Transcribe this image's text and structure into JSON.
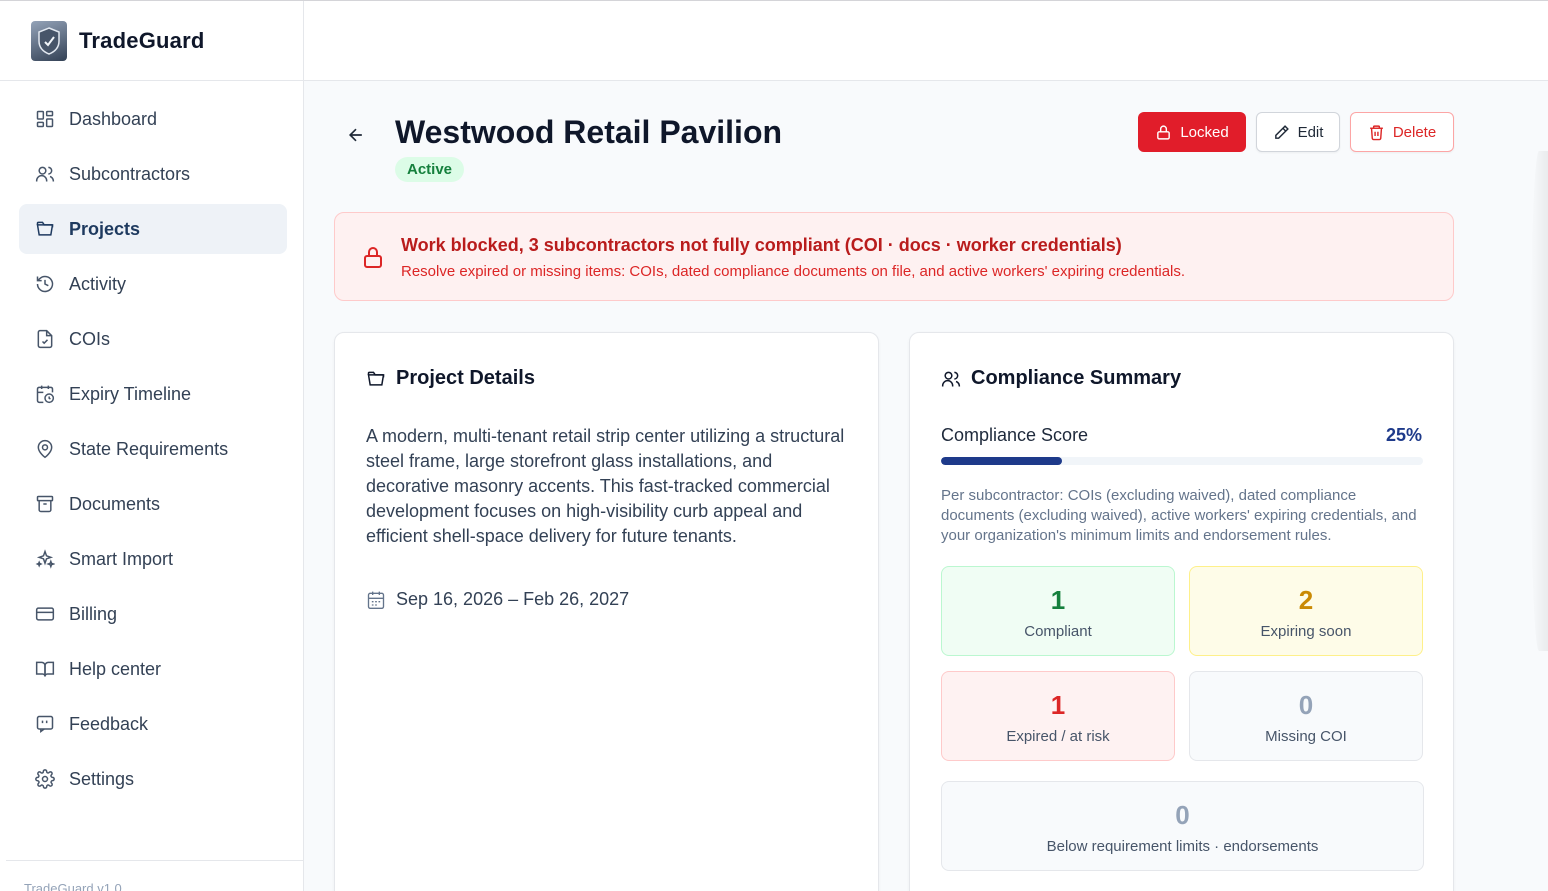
{
  "app": {
    "name": "TradeGuard",
    "version": "TradeGuard v1.0"
  },
  "sidebar": {
    "items": [
      {
        "label": "Dashboard",
        "icon": "dashboard-icon"
      },
      {
        "label": "Subcontractors",
        "icon": "users-icon"
      },
      {
        "label": "Projects",
        "icon": "folder-icon",
        "active": true
      },
      {
        "label": "Activity",
        "icon": "history-icon"
      },
      {
        "label": "COIs",
        "icon": "file-check-icon"
      },
      {
        "label": "Expiry Timeline",
        "icon": "calendar-clock-icon"
      },
      {
        "label": "State Requirements",
        "icon": "map-pin-icon"
      },
      {
        "label": "Documents",
        "icon": "archive-icon"
      },
      {
        "label": "Smart Import",
        "icon": "sparkles-icon"
      },
      {
        "label": "Billing",
        "icon": "credit-card-icon"
      },
      {
        "label": "Help center",
        "icon": "book-icon"
      },
      {
        "label": "Feedback",
        "icon": "message-quote-icon"
      },
      {
        "label": "Settings",
        "icon": "gear-icon"
      }
    ]
  },
  "project": {
    "title": "Westwood Retail Pavilion",
    "status": "Active",
    "actions": {
      "locked": "Locked",
      "edit": "Edit",
      "delete": "Delete"
    }
  },
  "alert": {
    "title": "Work blocked, 3 subcontractors not fully compliant (COI · docs · worker credentials)",
    "text": "Resolve expired or missing items: COIs, dated compliance documents on file, and active workers' expiring credentials."
  },
  "details": {
    "title": "Project Details",
    "description": "A modern, multi-tenant retail strip center utilizing a structural steel frame, large storefront glass installations, and decorative masonry accents. This fast-tracked commercial development focuses on high-visibility curb appeal and efficient shell-space delivery for future tenants.",
    "dates": "Sep 16, 2026 – Feb 26, 2027"
  },
  "compliance": {
    "title": "Compliance Summary",
    "score_label": "Compliance Score",
    "score_text": "25%",
    "score_fraction": 0.25,
    "note": "Per subcontractor: COIs (excluding waived), dated compliance documents (excluding waived), active workers' expiring credentials, and your organization's minimum limits and endorsement rules.",
    "stats": {
      "compliant": {
        "value": "1",
        "label": "Compliant"
      },
      "expiring": {
        "value": "2",
        "label": "Expiring soon"
      },
      "expired": {
        "value": "1",
        "label": "Expired / at risk"
      },
      "missing": {
        "value": "0",
        "label": "Missing COI"
      },
      "below": {
        "value": "0",
        "label": "Below requirement limits · endorsements"
      }
    }
  },
  "colors": {
    "accent": "#1e3a8a",
    "danger": "#e11d2a",
    "success": "#15803d",
    "warning": "#ca8a04"
  }
}
